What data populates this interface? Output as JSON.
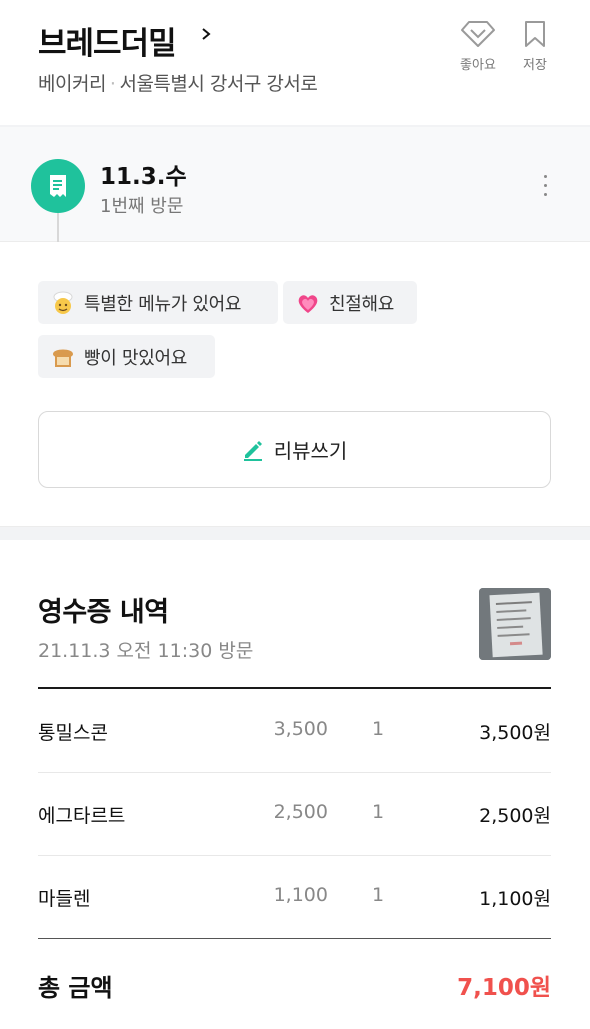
{
  "header": {
    "place_name": "브레드더밀",
    "category": "베이커리",
    "address": "서울특별시 강서구 강서로",
    "like_label": "좋아요",
    "save_label": "저장"
  },
  "visit": {
    "date": "11.3.수",
    "count": "1번째 방문"
  },
  "tags": [
    {
      "label": "특별한 메뉴가 있어요",
      "icon": "chef-emoji-icon"
    },
    {
      "label": "친절해요",
      "icon": "heart-emoji-icon"
    },
    {
      "label": "빵이 맛있어요",
      "icon": "bread-emoji-icon"
    }
  ],
  "review_button": {
    "label": "리뷰쓰기"
  },
  "receipt": {
    "title": "영수증 내역",
    "visited_at": "21.11.3 오전 11:30 방문",
    "items": [
      {
        "name": "통밀스콘",
        "price": "3,500",
        "qty": "1",
        "amount": "3,500원"
      },
      {
        "name": "에그타르트",
        "price": "2,500",
        "qty": "1",
        "amount": "2,500원"
      },
      {
        "name": "마들렌",
        "price": "1,100",
        "qty": "1",
        "amount": "1,100원"
      }
    ],
    "total_label": "총 금액",
    "total_value": "7,100원"
  },
  "colors": {
    "accent_green": "#1fc29c",
    "total_red": "#f0514d"
  }
}
